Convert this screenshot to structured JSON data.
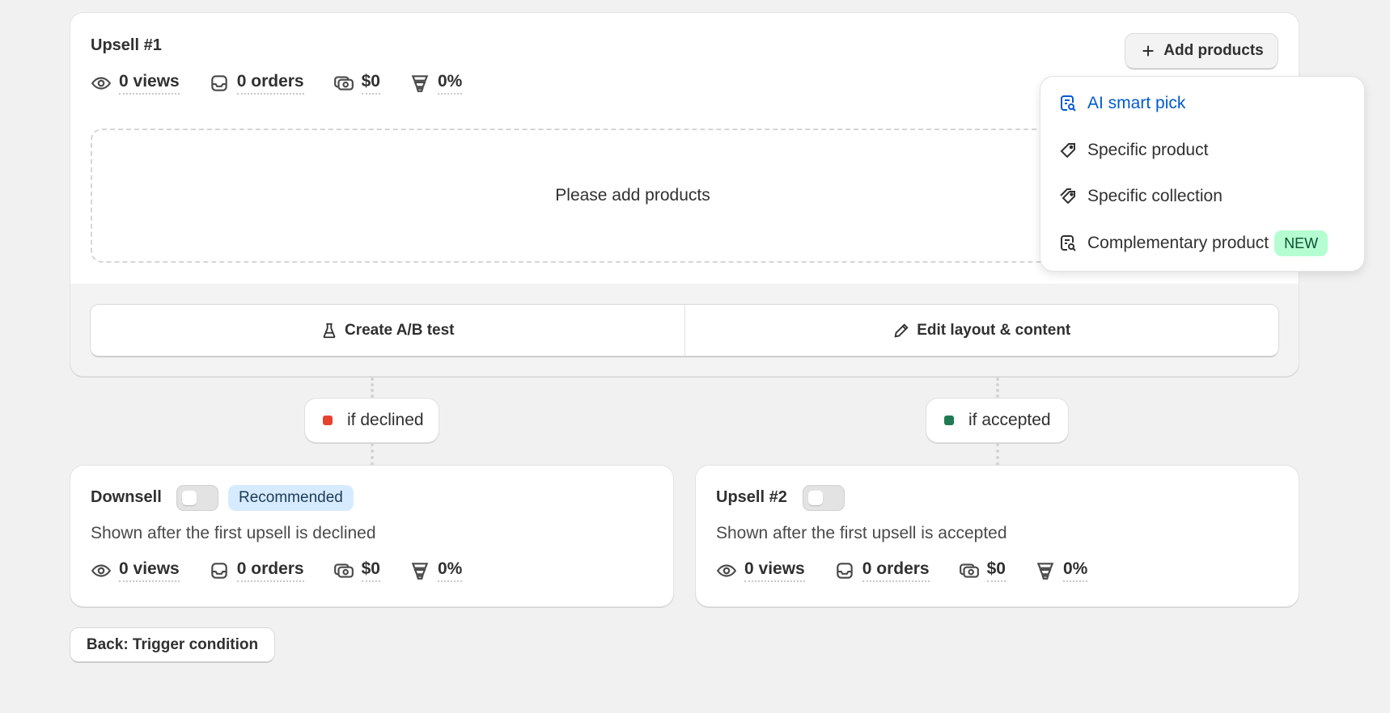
{
  "upsell1": {
    "title": "Upsell #1",
    "add_products_label": "Add products",
    "stats": {
      "views": "0 views",
      "orders": "0 orders",
      "revenue": "$0",
      "conversion": "0%"
    },
    "empty_text": "Please add products",
    "ab_test_label": "Create A/B test",
    "edit_layout_label": "Edit layout & content"
  },
  "menu": {
    "items": [
      {
        "label": "AI smart pick",
        "icon": "ai-search-icon",
        "active": true
      },
      {
        "label": "Specific product",
        "icon": "tag-icon"
      },
      {
        "label": "Specific collection",
        "icon": "tags-icon"
      },
      {
        "label": "Complementary product",
        "icon": "product-search-icon",
        "badge": "NEW"
      }
    ]
  },
  "branches": {
    "declined": {
      "label": "if declined",
      "color": "#e5432f"
    },
    "accepted": {
      "label": "if accepted",
      "color": "#1f7a52"
    }
  },
  "downsell": {
    "title": "Downsell",
    "badge": "Recommended",
    "description": "Shown after the first upsell is declined",
    "stats": {
      "views": "0 views",
      "orders": "0 orders",
      "revenue": "$0",
      "conversion": "0%"
    }
  },
  "upsell2": {
    "title": "Upsell #2",
    "description": "Shown after the first upsell is accepted",
    "stats": {
      "views": "0 views",
      "orders": "0 orders",
      "revenue": "$0",
      "conversion": "0%"
    }
  },
  "footer": {
    "back_label": "Back: Trigger condition"
  }
}
